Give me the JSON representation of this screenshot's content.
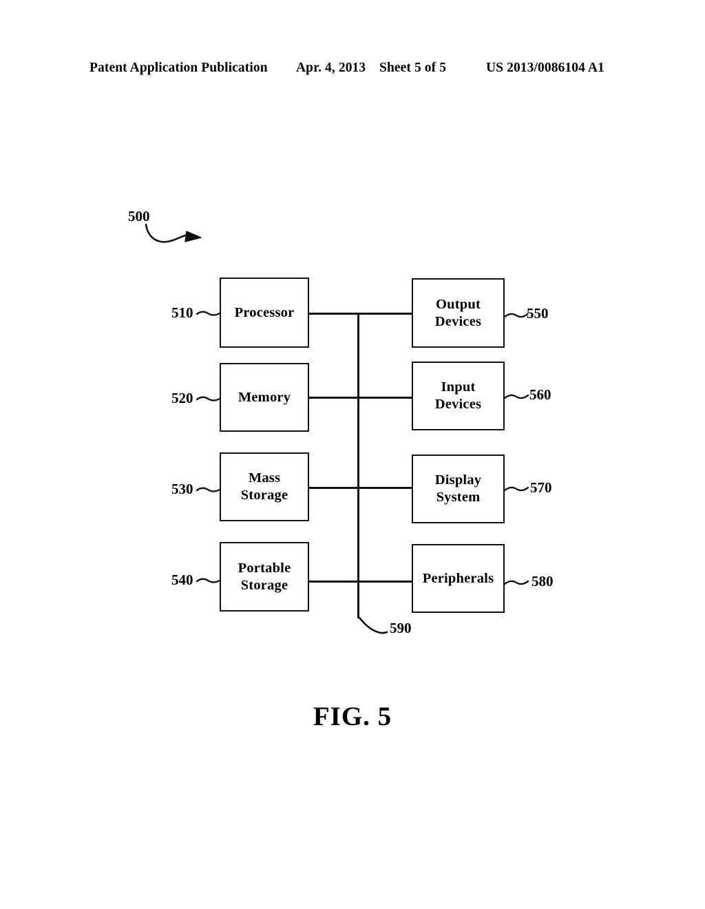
{
  "header": {
    "publication": "Patent Application Publication",
    "date": "Apr. 4, 2013",
    "sheet": "Sheet 5 of 5",
    "publication_number": "US 2013/0086104 A1"
  },
  "figure": {
    "caption": "FIG. 5",
    "system_numeral": "500",
    "bus_numeral": "590",
    "blocks": [
      {
        "id": "processor",
        "label": "Processor",
        "numeral": "510",
        "column": "left",
        "row": 1
      },
      {
        "id": "memory",
        "label": "Memory",
        "numeral": "520",
        "column": "left",
        "row": 2
      },
      {
        "id": "mass-storage",
        "label": "Mass\nStorage",
        "numeral": "530",
        "column": "left",
        "row": 3
      },
      {
        "id": "portable-storage",
        "label": "Portable\nStorage",
        "numeral": "540",
        "column": "left",
        "row": 4
      },
      {
        "id": "output-devices",
        "label": "Output\nDevices",
        "numeral": "550",
        "column": "right",
        "row": 1
      },
      {
        "id": "input-devices",
        "label": "Input\nDevices",
        "numeral": "560",
        "column": "right",
        "row": 2
      },
      {
        "id": "display-system",
        "label": "Display\nSystem",
        "numeral": "570",
        "column": "right",
        "row": 3
      },
      {
        "id": "peripherals",
        "label": "Peripherals",
        "numeral": "580",
        "column": "right",
        "row": 4
      }
    ]
  },
  "colors": {
    "ink": "#111111",
    "paper": "#ffffff"
  }
}
